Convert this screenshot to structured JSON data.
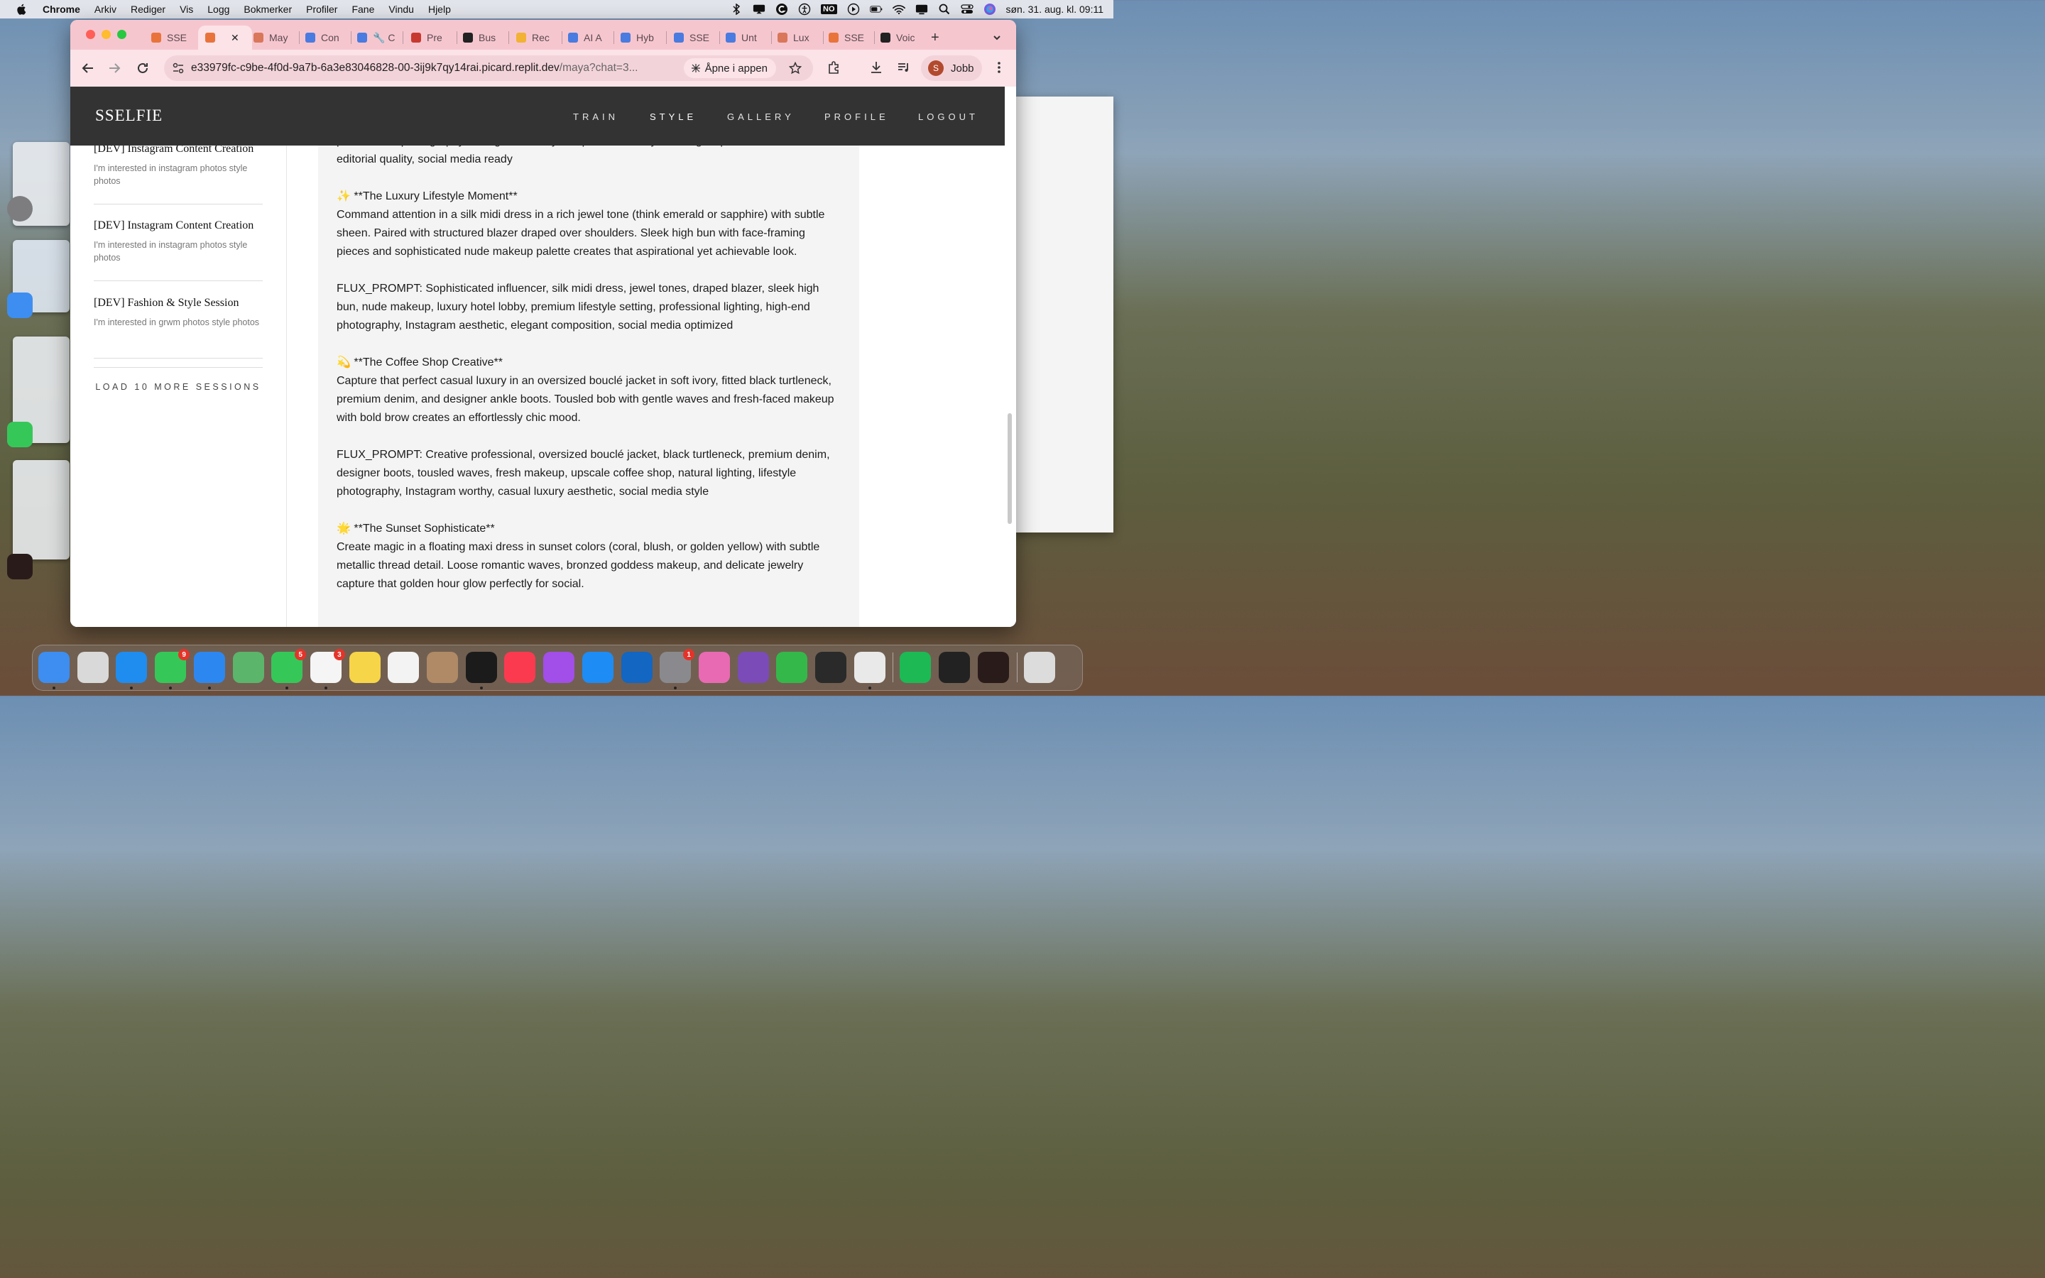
{
  "menubar": {
    "items": [
      "Chrome",
      "Arkiv",
      "Rediger",
      "Vis",
      "Logg",
      "Bokmerker",
      "Profiler",
      "Fane",
      "Vindu",
      "Hjelp"
    ],
    "status_no_badge": "NO",
    "clock": "søn. 31. aug. kl. 09:11"
  },
  "tabs": [
    {
      "label": "SSE",
      "color": "#e8743b"
    },
    {
      "label": "",
      "color": "#e8743b"
    },
    {
      "label": "May",
      "color": "#d9775a"
    },
    {
      "label": "Con",
      "color": "#4a7be0"
    },
    {
      "label": "🔧 C",
      "color": "#4a7be0"
    },
    {
      "label": "Pre",
      "color": "#c7392f"
    },
    {
      "label": "Bus",
      "color": "#222222"
    },
    {
      "label": "Rec",
      "color": "#f2b233"
    },
    {
      "label": "AI A",
      "color": "#4a7be0"
    },
    {
      "label": "Hyb",
      "color": "#4a7be0"
    },
    {
      "label": "SSE",
      "color": "#4a7be0"
    },
    {
      "label": "Unt",
      "color": "#4a7be0"
    },
    {
      "label": "Lux",
      "color": "#d9775a"
    },
    {
      "label": "SSE",
      "color": "#e8743b"
    },
    {
      "label": "Voic",
      "color": "#222222"
    }
  ],
  "omnibox": {
    "url_host": "e33979fc-c9be-4f0d-9a7b-6a3e83046828-00-3ij9k7qy14rai.picard.replit.dev",
    "url_path": "/maya?chat=3...",
    "open_in_app": "Åpne i appen"
  },
  "profile": {
    "initial": "S",
    "name": "Jobb"
  },
  "site": {
    "logo": "SSELFIE",
    "nav": [
      "TRAIN",
      "STYLE",
      "GALLERY",
      "PROFILE",
      "LOGOUT"
    ]
  },
  "sessions": [
    {
      "title": "[DEV] Instagram Content Creation",
      "desc": "I'm interested in instagram photos style photos"
    },
    {
      "title": "[DEV] Instagram Content Creation",
      "desc": "I'm interested in instagram photos style photos"
    },
    {
      "title": "[DEV] Fashion & Style Session",
      "desc": "I'm interested in grwm photos style photos"
    }
  ],
  "load_more": "LOAD 10 MORE SESSIONS",
  "chat": {
    "partial_top": "leather pants, layered gold jewelry, soft waves, glowing natural makeup, high-end studio lighting,",
    "paragraphs": [
      "professional photography, Instagram-worthy composition, lifestyle setting, expensive aesthetic, editorial quality, social media ready",
      "✨ **The Luxury Lifestyle Moment**\nCommand attention in a silk midi dress in a rich jewel tone (think emerald or sapphire) with subtle sheen. Paired with structured blazer draped over shoulders. Sleek high bun with face-framing pieces and sophisticated nude makeup palette creates that aspirational yet achievable look.",
      "FLUX_PROMPT: Sophisticated influencer, silk midi dress, jewel tones, draped blazer, sleek high bun, nude makeup, luxury hotel lobby, premium lifestyle setting, professional lighting, high-end photography, Instagram aesthetic, elegant composition, social media optimized",
      "💫 **The Coffee Shop Creative**\nCapture that perfect casual luxury in an oversized bouclé jacket in soft ivory, fitted black turtleneck, premium denim, and designer ankle boots. Tousled bob with gentle waves and fresh-faced makeup with bold brow creates an effortlessly chic mood.",
      "FLUX_PROMPT: Creative professional, oversized bouclé jacket, black turtleneck, premium denim, designer boots, tousled waves, fresh makeup, upscale coffee shop, natural lighting, lifestyle photography, Instagram worthy, casual luxury aesthetic, social media style",
      "🌟 **The Sunset Sophisticate**\nCreate magic in a floating maxi dress in sunset colors (coral, blush, or golden yellow) with subtle metallic thread detail. Loose romantic waves, bronzed goddess makeup, and delicate jewelry capture that golden hour glow perfectly for social."
    ]
  },
  "dock": {
    "apps": [
      {
        "name": "Finder",
        "color": "#3d8ef0",
        "badge": ""
      },
      {
        "name": "Launchpad",
        "color": "#d9d9d9",
        "badge": ""
      },
      {
        "name": "Safari",
        "color": "#1f8cf0",
        "badge": ""
      },
      {
        "name": "Messages",
        "color": "#36c759",
        "badge": "9"
      },
      {
        "name": "Mail",
        "color": "#2d87f0",
        "badge": ""
      },
      {
        "name": "Maps",
        "color": "#5bb56a",
        "badge": ""
      },
      {
        "name": "FaceTime",
        "color": "#36c759",
        "badge": "5"
      },
      {
        "name": "Reminders",
        "color": "#f5f5f5",
        "badge": "3"
      },
      {
        "name": "Notes",
        "color": "#f7d548",
        "badge": ""
      },
      {
        "name": "Freeform",
        "color": "#f3f3f3",
        "badge": ""
      },
      {
        "name": "Contacts",
        "color": "#b08a66",
        "badge": ""
      },
      {
        "name": "TV",
        "color": "#1b1b1b",
        "badge": ""
      },
      {
        "name": "Music",
        "color": "#fb3a50",
        "badge": ""
      },
      {
        "name": "Podcasts",
        "color": "#a24ee8",
        "badge": ""
      },
      {
        "name": "App Store",
        "color": "#1d8cf4",
        "badge": ""
      },
      {
        "name": "Outlook",
        "color": "#1366c2",
        "badge": ""
      },
      {
        "name": "System Settings",
        "color": "#8a8a8e",
        "badge": "1"
      },
      {
        "name": "Keynote",
        "color": "#e86ab3",
        "badge": ""
      },
      {
        "name": "GitHub",
        "color": "#7b4bb8",
        "badge": ""
      },
      {
        "name": "Numbers",
        "color": "#35b84a",
        "badge": ""
      },
      {
        "name": "Perplexity",
        "color": "#2a2a2a",
        "badge": ""
      },
      {
        "name": "Chrome",
        "color": "#e9e9e9",
        "badge": ""
      },
      {
        "name": "Spotify",
        "color": "#1db954",
        "badge": ""
      },
      {
        "name": "Cube",
        "color": "#222222",
        "badge": ""
      },
      {
        "name": "Voice Memos",
        "color": "#2a1b1b",
        "badge": ""
      },
      {
        "name": "Trash",
        "color": "#dcdcdc",
        "badge": ""
      }
    ]
  },
  "colors": {
    "nav_bg": "#333333",
    "tab_strip": "#f6c6cf",
    "toolbar": "#fbe3e8",
    "chat_bg": "#f4f4f4"
  }
}
